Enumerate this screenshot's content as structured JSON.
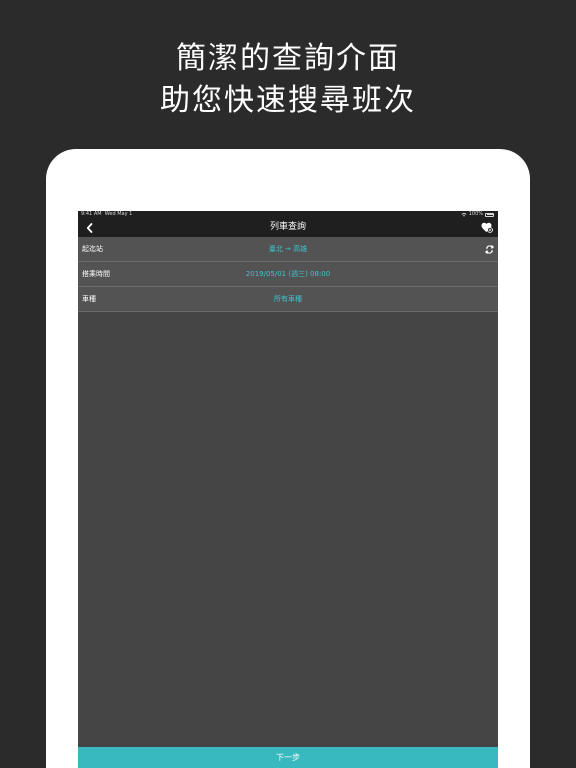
{
  "promo": {
    "line1": "簡潔的查詢介面",
    "line2": "助您快速搜尋班次"
  },
  "statusbar": {
    "time": "9:41 AM",
    "date": "Wed May 1",
    "battery": "100%",
    "battery_level": 1.0
  },
  "navbar": {
    "title": "列車查詢",
    "back_icon": "chevron-left-icon",
    "favorite_icon": "heart-plus-icon"
  },
  "rows": [
    {
      "label": "起迄站",
      "value": "臺北 → 高雄",
      "accessory_icon": "swap-arrows-icon"
    },
    {
      "label": "搭乘時間",
      "value": "2019/05/01 (週三) 08:00"
    },
    {
      "label": "車種",
      "value": "所有車種"
    }
  ],
  "footer": {
    "next_label": "下一步"
  },
  "colors": {
    "background": "#2b2b2b",
    "screen": "#454545",
    "bar": "#1f1f1f",
    "row": "#535353",
    "accent": "#38b9bf",
    "value_text": "#3cc3cc"
  }
}
